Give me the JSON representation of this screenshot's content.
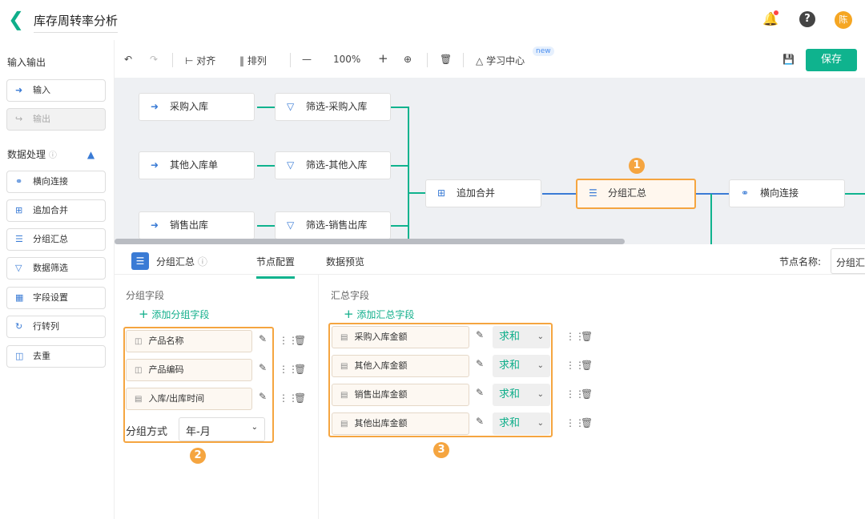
{
  "header": {
    "title": "库存周转率分析",
    "avatar": "陈"
  },
  "sidebar": {
    "io_title": "输入输出",
    "input": "输入",
    "output": "输出",
    "proc_title": "数据处理",
    "items": [
      {
        "label": "横向连接",
        "icon": "link-icon"
      },
      {
        "label": "追加合并",
        "icon": "merge-icon"
      },
      {
        "label": "分组汇总",
        "icon": "list-icon"
      },
      {
        "label": "数据筛选",
        "icon": "filter-icon"
      },
      {
        "label": "字段设置",
        "icon": "table-icon"
      },
      {
        "label": "行转列",
        "icon": "pivot-icon"
      },
      {
        "label": "去重",
        "icon": "dedupe-icon"
      }
    ]
  },
  "toolbar": {
    "align": "对齐",
    "arrange": "排列",
    "zoom": "100%",
    "learn": "学习中心",
    "new": "new",
    "save": "保存"
  },
  "canvas": {
    "sources": [
      "采购入库",
      "其他入库单",
      "销售出库"
    ],
    "filters": [
      "筛选-采购入库",
      "筛选-其他入库",
      "筛选-销售出库"
    ],
    "merge": "追加合并",
    "group": "分组汇总",
    "join": "横向连接",
    "badge1": "1"
  },
  "panel": {
    "node_title": "分组汇总",
    "tabs": [
      "节点配置",
      "数据预览"
    ],
    "node_name_label": "节点名称:",
    "node_name_value": "分组汇总",
    "group_title": "分组字段",
    "add_group": "添加分组字段",
    "group_fields": [
      "产品名称",
      "产品编码",
      "入库/出库时间"
    ],
    "group_mode_label": "分组方式",
    "group_mode": "年-月",
    "badge2": "2",
    "agg_title": "汇总字段",
    "add_agg": "添加汇总字段",
    "agg_fields": [
      {
        "name": "采购入库金额",
        "fn": "求和"
      },
      {
        "name": "其他入库金额",
        "fn": "求和"
      },
      {
        "name": "销售出库金额",
        "fn": "求和"
      },
      {
        "name": "其他出库金额",
        "fn": "求和"
      }
    ],
    "badge3": "3"
  }
}
